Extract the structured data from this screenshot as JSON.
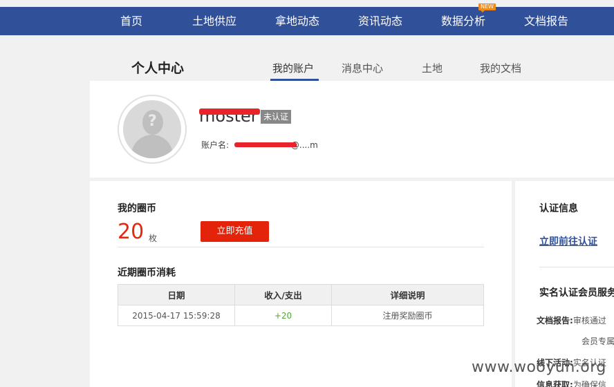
{
  "nav": {
    "items": [
      {
        "label": "首页"
      },
      {
        "label": "土地供应"
      },
      {
        "label": "拿地动态"
      },
      {
        "label": "资讯动态"
      },
      {
        "label": "数据分析",
        "badge": "NEW"
      },
      {
        "label": "文档报告"
      }
    ]
  },
  "header": {
    "title": "个人中心",
    "tabs": [
      {
        "label": "我的账户",
        "active": true
      },
      {
        "label": "消息中心"
      },
      {
        "label": "土地"
      },
      {
        "label": "我的文档"
      }
    ]
  },
  "profile": {
    "username": "moster",
    "verify_status": "未认证",
    "account_label": "账户名:",
    "account_value_tail": "@....m"
  },
  "coins": {
    "title": "我的圈币",
    "count": "20",
    "unit": "枚",
    "recharge_label": "立即充值"
  },
  "records": {
    "title": "近期圈币消耗",
    "columns": [
      "日期",
      "收入/支出",
      "详细说明"
    ],
    "rows": [
      {
        "date": "2015-04-17 15:59:28",
        "amount": "+20",
        "desc": "注册奖励圈币"
      }
    ]
  },
  "side": {
    "verify_title": "认证信息",
    "verify_link": "立即前往认证",
    "service_title": "实名认证会员服务",
    "lines": [
      {
        "label": "文档报告:",
        "text": "审核通过"
      },
      {
        "label": "",
        "text": "会员专属"
      },
      {
        "label": "线下活动:",
        "text": "实名认证"
      },
      {
        "label": "信息获取:",
        "text": "为确保信"
      }
    ]
  },
  "watermark": "www.wooyun.org",
  "colors": {
    "nav_bg": "#30509a",
    "accent_red": "#e4230b",
    "income_green": "#55a532"
  }
}
